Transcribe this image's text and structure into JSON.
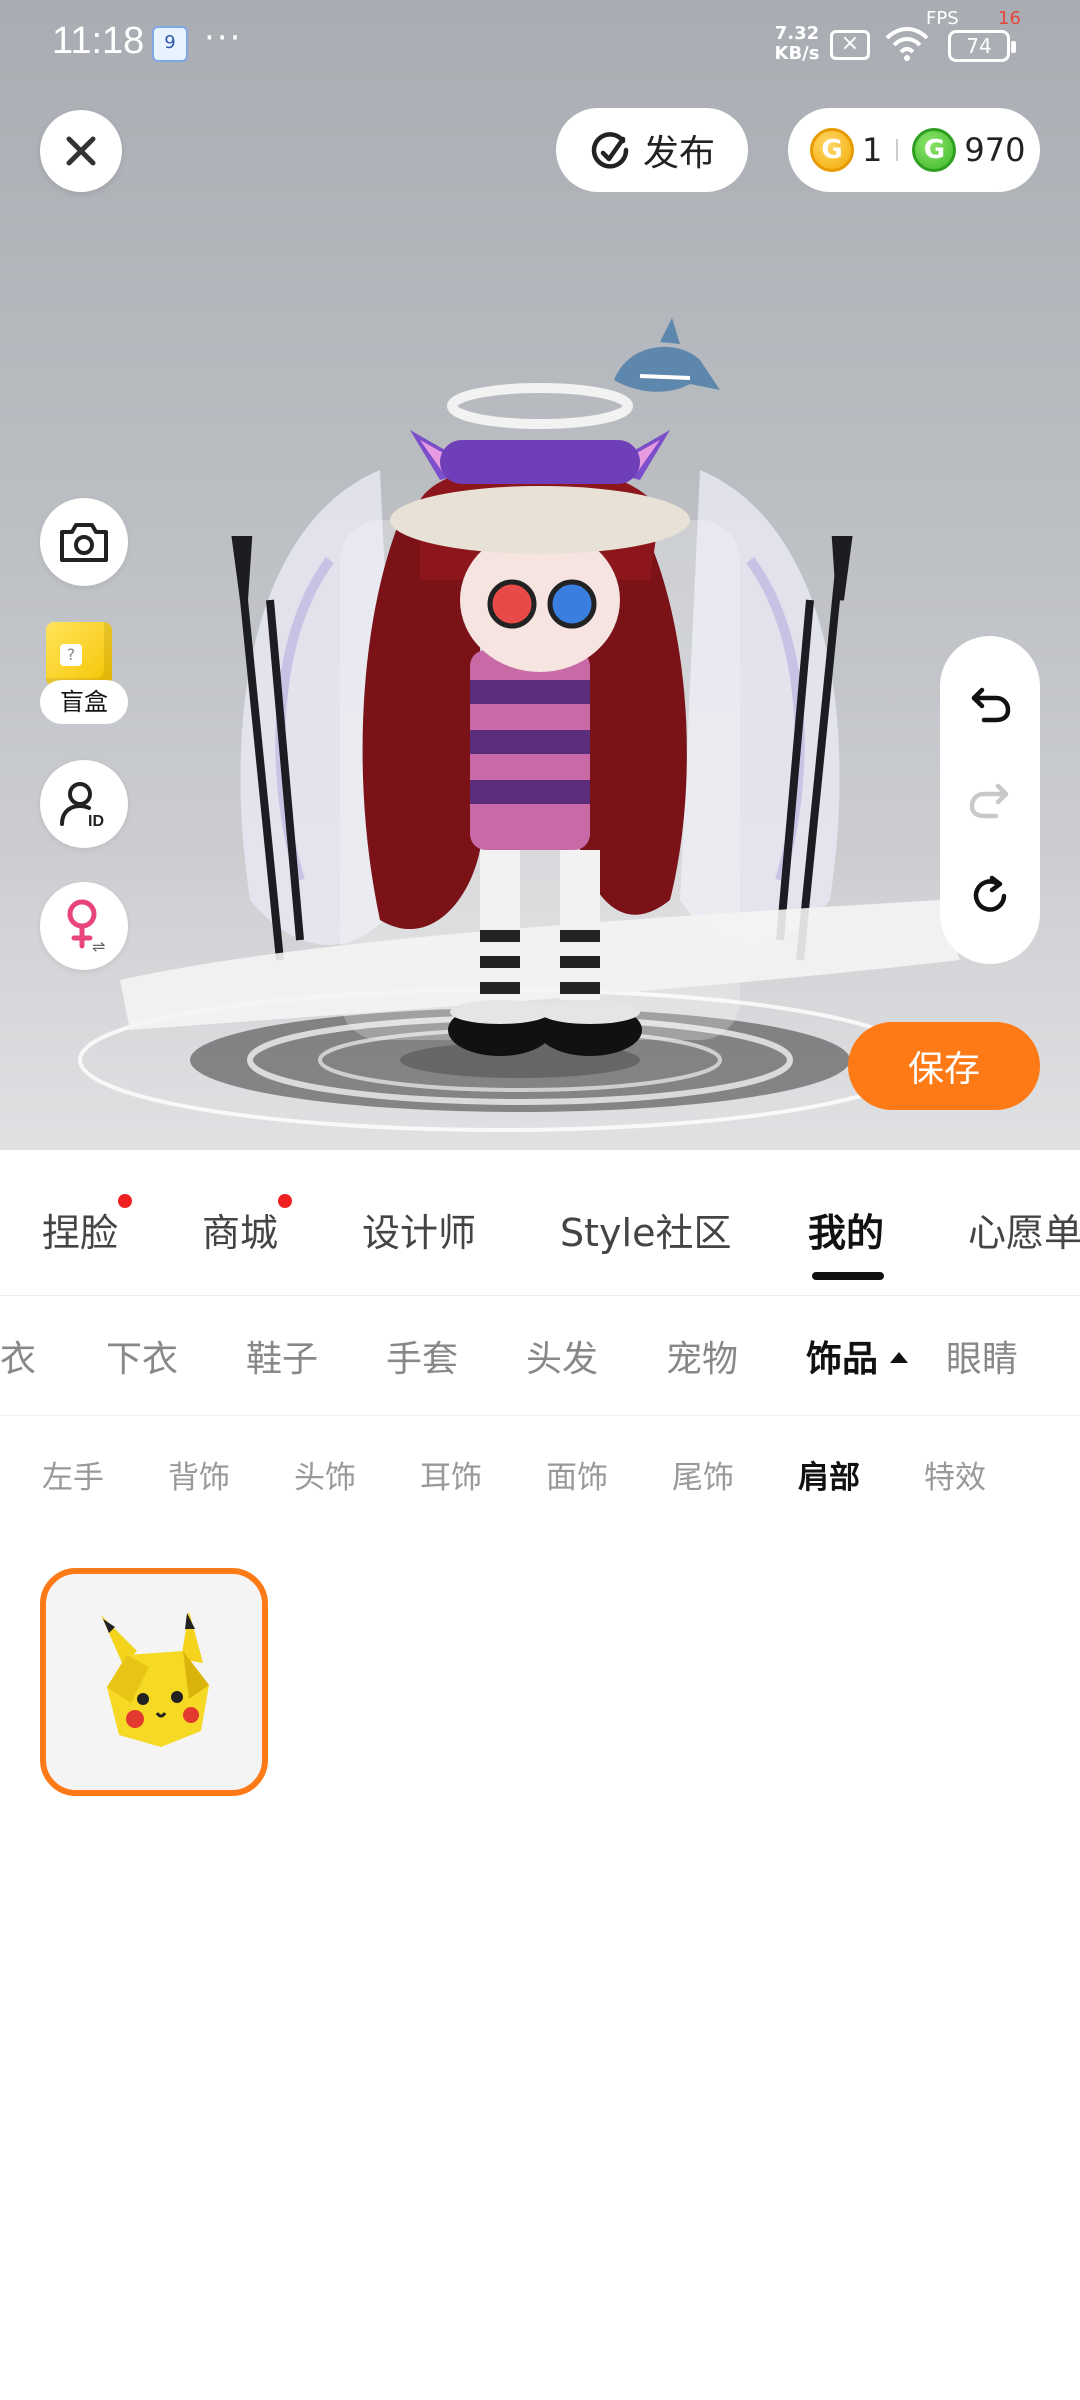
{
  "status_bar": {
    "time": "11:18",
    "app_badge": "9",
    "more": "···",
    "net_speed_value": "7.32",
    "net_speed_unit": "KB/s",
    "fps_label": "FPS",
    "fps_value": "16",
    "battery": "74"
  },
  "top_bar": {
    "publish_label": "发布",
    "gold_coins": "1",
    "green_coins": "970"
  },
  "side_tools": {
    "blindbox_label": "盲盒",
    "icons": [
      "camera-icon",
      "blindbox-icon",
      "user-id-icon",
      "female-gender-icon"
    ]
  },
  "history": {
    "icons": [
      "undo-icon",
      "redo-icon",
      "reset-icon"
    ]
  },
  "save_label": "保存",
  "main_tabs": [
    {
      "label": "捏脸",
      "dot": true
    },
    {
      "label": "商城",
      "dot": true
    },
    {
      "label": "设计师",
      "dot": false
    },
    {
      "label": "Style社区",
      "dot": false
    },
    {
      "label": "我的",
      "dot": false,
      "active": true
    },
    {
      "label": "心愿单",
      "dot": false
    }
  ],
  "category_tabs": [
    {
      "label": "上衣"
    },
    {
      "label": "下衣"
    },
    {
      "label": "鞋子"
    },
    {
      "label": "手套"
    },
    {
      "label": "头发"
    },
    {
      "label": "宠物"
    },
    {
      "label": "饰品",
      "active": true
    },
    {
      "label": "眼睛"
    }
  ],
  "sub_tabs": [
    {
      "label": "左手"
    },
    {
      "label": "背饰"
    },
    {
      "label": "头饰"
    },
    {
      "label": "耳饰"
    },
    {
      "label": "面饰"
    },
    {
      "label": "尾饰"
    },
    {
      "label": "肩部",
      "active": true
    },
    {
      "label": "特效"
    }
  ],
  "items": [
    {
      "name": "pikachu-head-shoulder-item",
      "selected": true
    }
  ],
  "colors": {
    "accent": "#fe7a17",
    "badge_red": "#ee2020",
    "gold_coin": "#f2a900",
    "green_coin": "#3cb92a"
  }
}
